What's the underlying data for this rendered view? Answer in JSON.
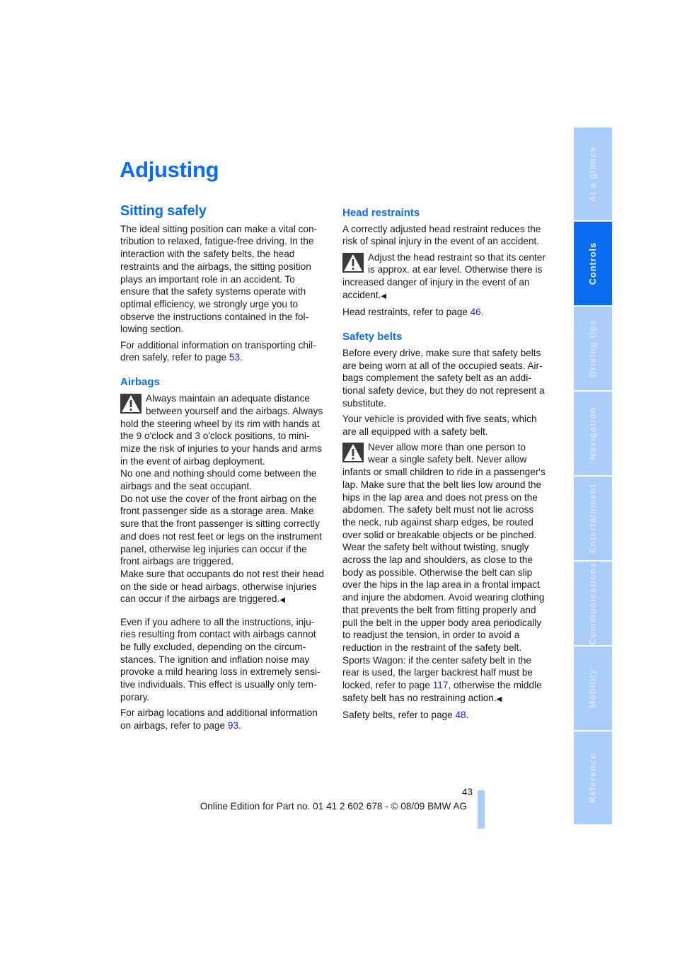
{
  "page": {
    "title": "Adjusting",
    "page_number": "43",
    "footer": "Online Edition for Part no. 01 41 2 602 678 - © 08/09 BMW AG",
    "accent_color": "#0a6cf0",
    "tab_color": "#aacdfa",
    "link_color": "#1a1af0"
  },
  "left": {
    "section_title": "Sitting safely",
    "intro": "The ideal sitting position can make a vital con-\ntribution to relaxed, fatigue-free driving. In the\ninteraction with the safety belts, the head\nrestraints and the airbags, the sitting position\nplays an important role in an accident. To\nensure that the safety systems operate with\noptimal efficiency, we strongly urge you to\nobserve the instructions contained in the fol-\nlowing section.",
    "children_pre": "For additional information on transporting chil-\ndren safely, refer to page ",
    "children_link": "53",
    "children_post": ".",
    "airbags_title": "Airbags",
    "airbags_warning": "Always maintain an adequate distance\nbetween yourself and the airbags. Always\nhold the steering wheel by its rim with hands at\nthe 9 o'clock and 3 o'clock positions, to mini-\nmize the risk of injuries to your hands and arms\nin the event of airbag deployment.\nNo one and nothing should come between the\nairbags and the seat occupant.\nDo not use the cover of the front airbag on the\nfront passenger side as a storage area. Make\nsure that the front passenger is sitting correctly\nand does not rest feet or legs on the instrument\npanel, otherwise leg injuries can occur if the\nfront airbags are triggered.\nMake sure that occupants do not rest their head\non the side or head airbags, otherwise injuries\ncan occur if the airbags are triggered.",
    "airbags_note": "Even if you adhere to all the instructions, inju-\nries resulting from contact with airbags cannot\nbe fully excluded, depending on the circum-\nstances. The ignition and inflation noise may\nprovoke a mild hearing loss in extremely sensi-\ntive individuals. This effect is usually only tem-\nporary.",
    "airbags_ref_pre": "For airbag locations and additional information\non airbags, refer to page ",
    "airbags_ref_link": "93",
    "airbags_ref_post": "."
  },
  "right": {
    "head_title": "Head restraints",
    "head_intro": "A correctly adjusted head restraint reduces the\nrisk of spinal injury in the event of an accident.",
    "head_warning": "Adjust the head restraint so that its center\nis approx. at ear level. Otherwise there is\nincreased danger of injury in the event of an\naccident.",
    "head_ref_pre": "Head restraints, refer to page ",
    "head_ref_link": "46",
    "head_ref_post": ".",
    "belts_title": "Safety belts",
    "belts_intro": "Before every drive, make sure that safety belts\nare being worn at all of the occupied seats. Air-\nbags complement the safety belt as an addi-\ntional safety device, but they do not represent a\nsubstitute.",
    "belts_seats": "Your vehicle is provided with five seats, which\nare all equipped with a safety belt.",
    "belts_warning": "Never allow more than one person to\nwear a single safety belt. Never allow\ninfants or small children to ride in a passenger's\nlap. Make sure that the belt lies low around the\nhips in the lap area and does not press on the\nabdomen. The safety belt must not lie across\nthe neck, rub against sharp edges, be routed\nover solid or breakable objects or be pinched.\nWear the safety belt without twisting, snugly\nacross the lap and shoulders, as close to the\nbody as possible. Otherwise the belt can slip\nover the hips in the lap area in a frontal impact\nand injure the abdomen. Avoid wearing clothing\nthat prevents the belt from fitting properly and\npull the belt in the upper body area periodically\nto readjust the tension, in order to avoid a\nreduction in the restraint of the safety belt.\nSports Wagon: if the center safety belt in the\nrear is used, the larger backrest half must be\nlocked, refer to page ",
    "belts_warning_link": "117",
    "belts_warning_post": ", otherwise the middle\nsafety belt has no restraining action.",
    "belts_ref_pre": "Safety belts, refer to page ",
    "belts_ref_link": "48",
    "belts_ref_post": "."
  },
  "end_mark": "◀",
  "tabs": [
    {
      "label": "At a glance",
      "active": false
    },
    {
      "label": "Controls",
      "active": true
    },
    {
      "label": "Driving tips",
      "active": false
    },
    {
      "label": "Navigation",
      "active": false
    },
    {
      "label": "Entertainment",
      "active": false
    },
    {
      "label": "Communications",
      "active": false
    },
    {
      "label": "Mobility",
      "active": false
    },
    {
      "label": "Reference",
      "active": false
    }
  ]
}
